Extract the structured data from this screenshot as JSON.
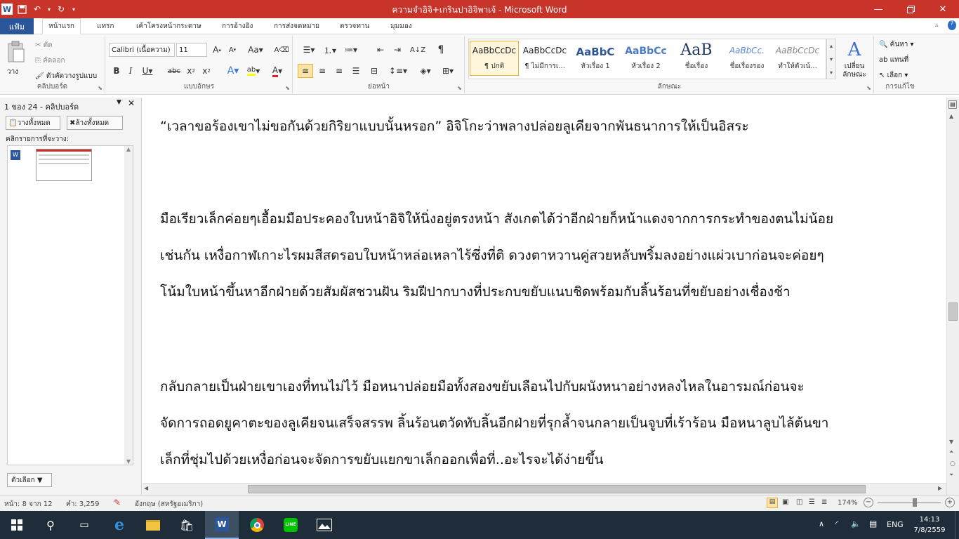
{
  "window": {
    "title": "ความจำอิจิ+เกรินปาอิจิพาเจ้ - Microsoft Word",
    "minimize_icon": "minimize-icon",
    "restore_icon": "restore-icon",
    "close_icon": "close-icon"
  },
  "qat": {
    "logo": "W",
    "save_icon": "save-icon",
    "undo_icon": "undo-icon",
    "redo_icon": "redo-icon"
  },
  "tabs": {
    "file": "แฟ้ม",
    "items": [
      "หน้าแรก",
      "แทรก",
      "เค้าโครงหน้ากระดาษ",
      "การอ้างอิง",
      "การส่งจดหมาย",
      "ตรวจทาน",
      "มุมมอง"
    ]
  },
  "ribbon": {
    "clipboard": {
      "label": "คลิปบอร์ด",
      "paste": "วาง",
      "cut": "ตัด",
      "copy": "คัดลอก",
      "format_painter": "ตัวคัดวางรูปแบบ"
    },
    "font": {
      "label": "แบบอักษร",
      "font_name": "Calibri (เนื้อความ)",
      "font_size": "11"
    },
    "paragraph": {
      "label": "ย่อหน้า"
    },
    "styles": {
      "label": "ลักษณะ",
      "items": [
        {
          "preview": "AaBbCcDc",
          "name": "¶ ปกติ"
        },
        {
          "preview": "AaBbCcDc",
          "name": "¶ ไม่มีการเ..."
        },
        {
          "preview": "AaBbC",
          "name": "หัวเรื่อง 1"
        },
        {
          "preview": "AaBbCc",
          "name": "หัวเรื่อง 2"
        },
        {
          "preview": "AaB",
          "name": "ชื่อเรื่อง"
        },
        {
          "preview": "AaBbCc.",
          "name": "ชื่อเรื่องรอง"
        },
        {
          "preview": "AaBbCcDc",
          "name": "ทำให้ตัวเน้..."
        }
      ],
      "change_styles": "เปลี่ยน",
      "change_styles_2": "ลักษณะ"
    },
    "editing": {
      "label": "การแก้ไข",
      "find": "ค้นหา",
      "replace": "แทนที่",
      "select": "เลือก"
    }
  },
  "clipboard_pane": {
    "title": "1 ของ 24 - คลิปบอร์ด",
    "paste_all": "วางทั้งหมด",
    "clear_all": "ล้างทั้งหมด",
    "instruction": "คลิกรายการที่จะวาง:",
    "options": "ตัวเลือก"
  },
  "document": {
    "paragraphs": [
      "“เวลาขอร้องเขาไม่ขอกันด้วยกิริยาแบบนั้นหรอก” อิจิโกะว่าพลางปล่อยลูเคียจากพันธนาการให้เป็นอิสระ",
      "มือเรียวเล็กค่อยๆเอื้อมมือประคองใบหน้าอิจิให้นิ่งอยู่ตรงหน้า สังเกตได้ว่าอีกฝ่ายก็หน้าแดงจากการกระทำของตนไม่น้อย",
      "เช่นกัน เหงื่อกาฬเกาะไรผมสีสดรอบใบหน้าหล่อเหลาไร้ซึ่งที่ติ ดวงตาหวานคู่สวยหลับพริ้มลงอย่างแผ่วเบาก่อนจะค่อยๆ",
      "โน้มใบหน้าขึ้นหาอีกฝ่ายด้วยสัมผัสชวนฝัน ริมฝีปากบางที่ประกบขยับแนบชิดพร้อมกับลิ้นร้อนที่ขยับอย่างเชื่องช้า",
      "กลับกลายเป็นฝ่ายเขาเองที่ทนไม่ไว้  มือหนาปล่อยมือทั้งสองขยับเลือนไปกับผนังหนาอย่างหลงไหลในอารมณ์ก่อนจะ",
      "จัดการถอดยูคาตะของลูเคียจนเสร็จสรรพ  ลิ้นร้อนตวัดทับลิ้นอีกฝ่ายที่รุกล้ำจนกลายเป็นจูบที่เร้าร้อน มือหนาลูบไล้ต้นขา",
      "เล็กที่ชุ่มไปด้วยเหงื่อก่อนจะจัดการขยับแยกขาเล็กออกเพื่อที่..อะไรจะได้ง่ายขึ้น"
    ]
  },
  "status": {
    "page": "หน้า: 8 จาก 12",
    "words": "คำ: 3,259",
    "language": "อังกฤษ (สหรัฐอเมริกา)",
    "zoom": "174%"
  },
  "taskbar": {
    "language": "ENG",
    "time": "14:13",
    "date": "7/8/2559"
  },
  "colors": {
    "titlebar": "#c8332a",
    "file_tab": "#2b579a",
    "taskbar": "#1f2d3a"
  }
}
